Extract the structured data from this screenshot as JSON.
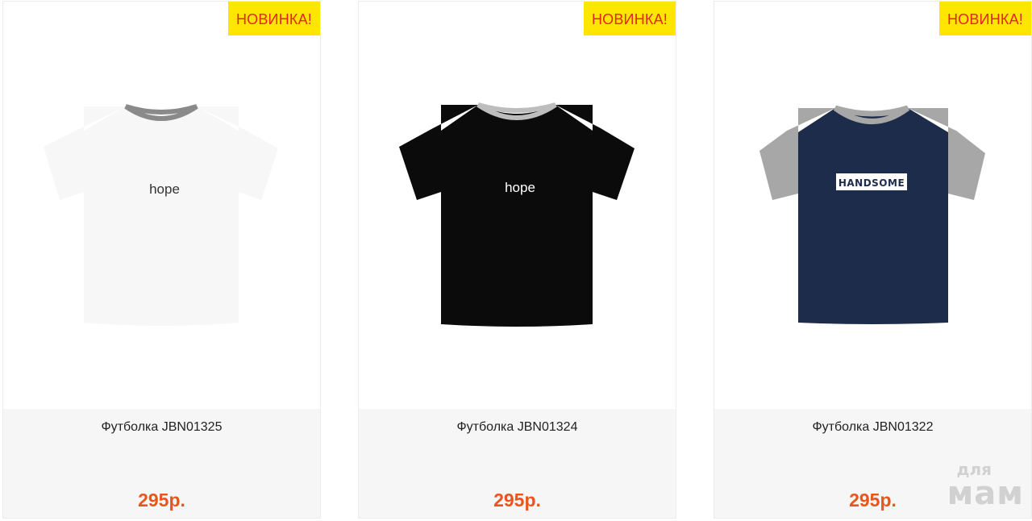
{
  "products": [
    {
      "badge": "НОВИНКА!",
      "title": "Футболка JBN01325",
      "price": "295р.",
      "print_text": "hope",
      "shirt_color": "#f7f7f7",
      "sleeve_color": "#f7f7f7",
      "collar_color": "#8a8a8a",
      "print_color": "#333333"
    },
    {
      "badge": "НОВИНКА!",
      "title": "Футболка JBN01324",
      "price": "295р.",
      "print_text": "hope",
      "shirt_color": "#0b0b0b",
      "sleeve_color": "#0b0b0b",
      "collar_color": "#bdbdbd",
      "print_color": "#ffffff"
    },
    {
      "badge": "НОВИНКА!",
      "title": "Футболка JBN01322",
      "price": "295р.",
      "print_text": "HANDSOME",
      "shirt_color": "#1c2c4a",
      "sleeve_color": "#a7a7a7",
      "collar_color": "#a7a7a7",
      "print_color": "#1c2c4a"
    }
  ],
  "watermark": {
    "top": "для",
    "bottom": "мам"
  },
  "colors": {
    "badge_bg": "#ffe600",
    "badge_text": "#e4261c",
    "price": "#e8561e",
    "info_bg": "#f6f6f6"
  }
}
